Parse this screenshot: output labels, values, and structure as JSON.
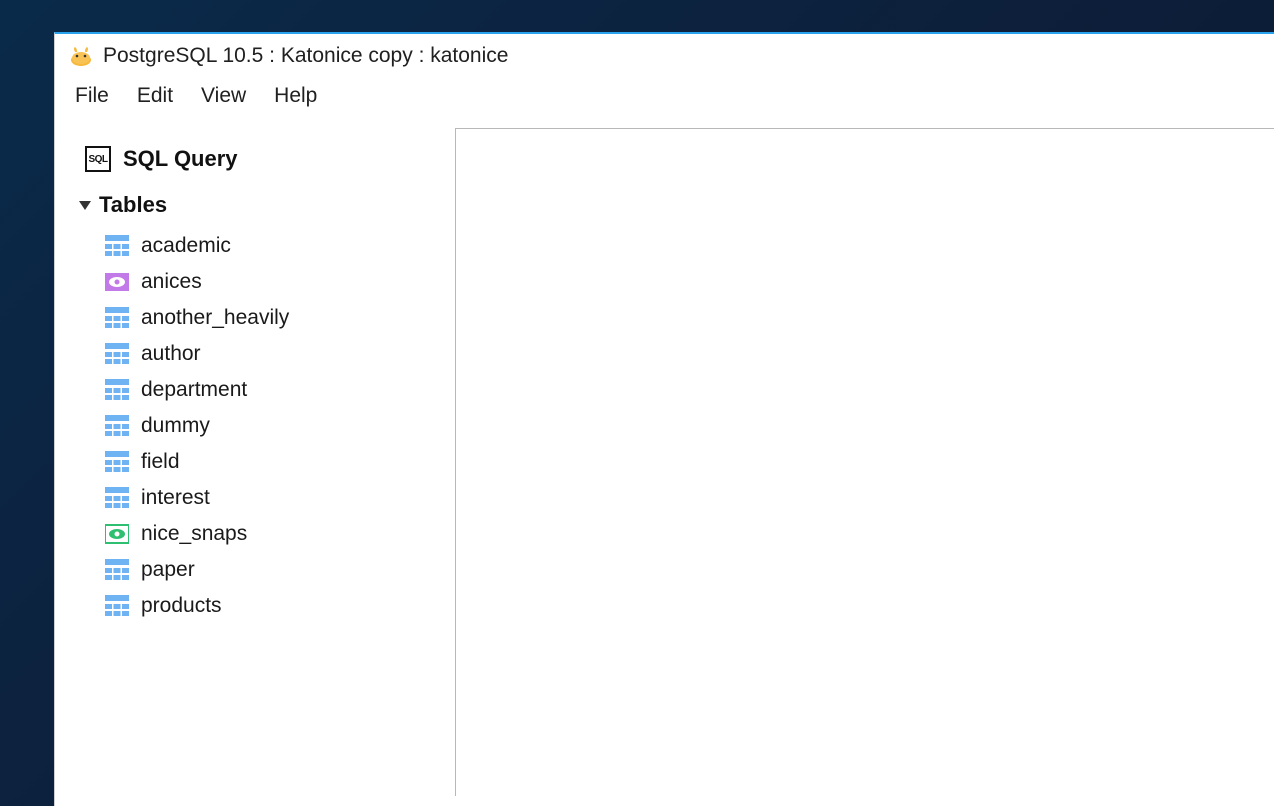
{
  "window": {
    "title": "PostgreSQL 10.5 : Katonice copy : katonice"
  },
  "menubar": {
    "items": [
      "File",
      "Edit",
      "View",
      "Help"
    ]
  },
  "sidebar": {
    "sql_query_label": "SQL Query",
    "tables_header": "Tables",
    "tables": [
      {
        "name": "academic",
        "icon": "table"
      },
      {
        "name": "anices",
        "icon": "view-purple"
      },
      {
        "name": "another_heavily",
        "icon": "table"
      },
      {
        "name": "author",
        "icon": "table"
      },
      {
        "name": "department",
        "icon": "table"
      },
      {
        "name": "dummy",
        "icon": "table"
      },
      {
        "name": "field",
        "icon": "table"
      },
      {
        "name": "interest",
        "icon": "table"
      },
      {
        "name": "nice_snaps",
        "icon": "view-green"
      },
      {
        "name": "paper",
        "icon": "table"
      },
      {
        "name": "products",
        "icon": "table"
      }
    ]
  },
  "icons": {
    "colors": {
      "table_blue": "#6fb3f2",
      "view_purple": "#c27ae8",
      "view_green": "#2fbf71"
    }
  }
}
